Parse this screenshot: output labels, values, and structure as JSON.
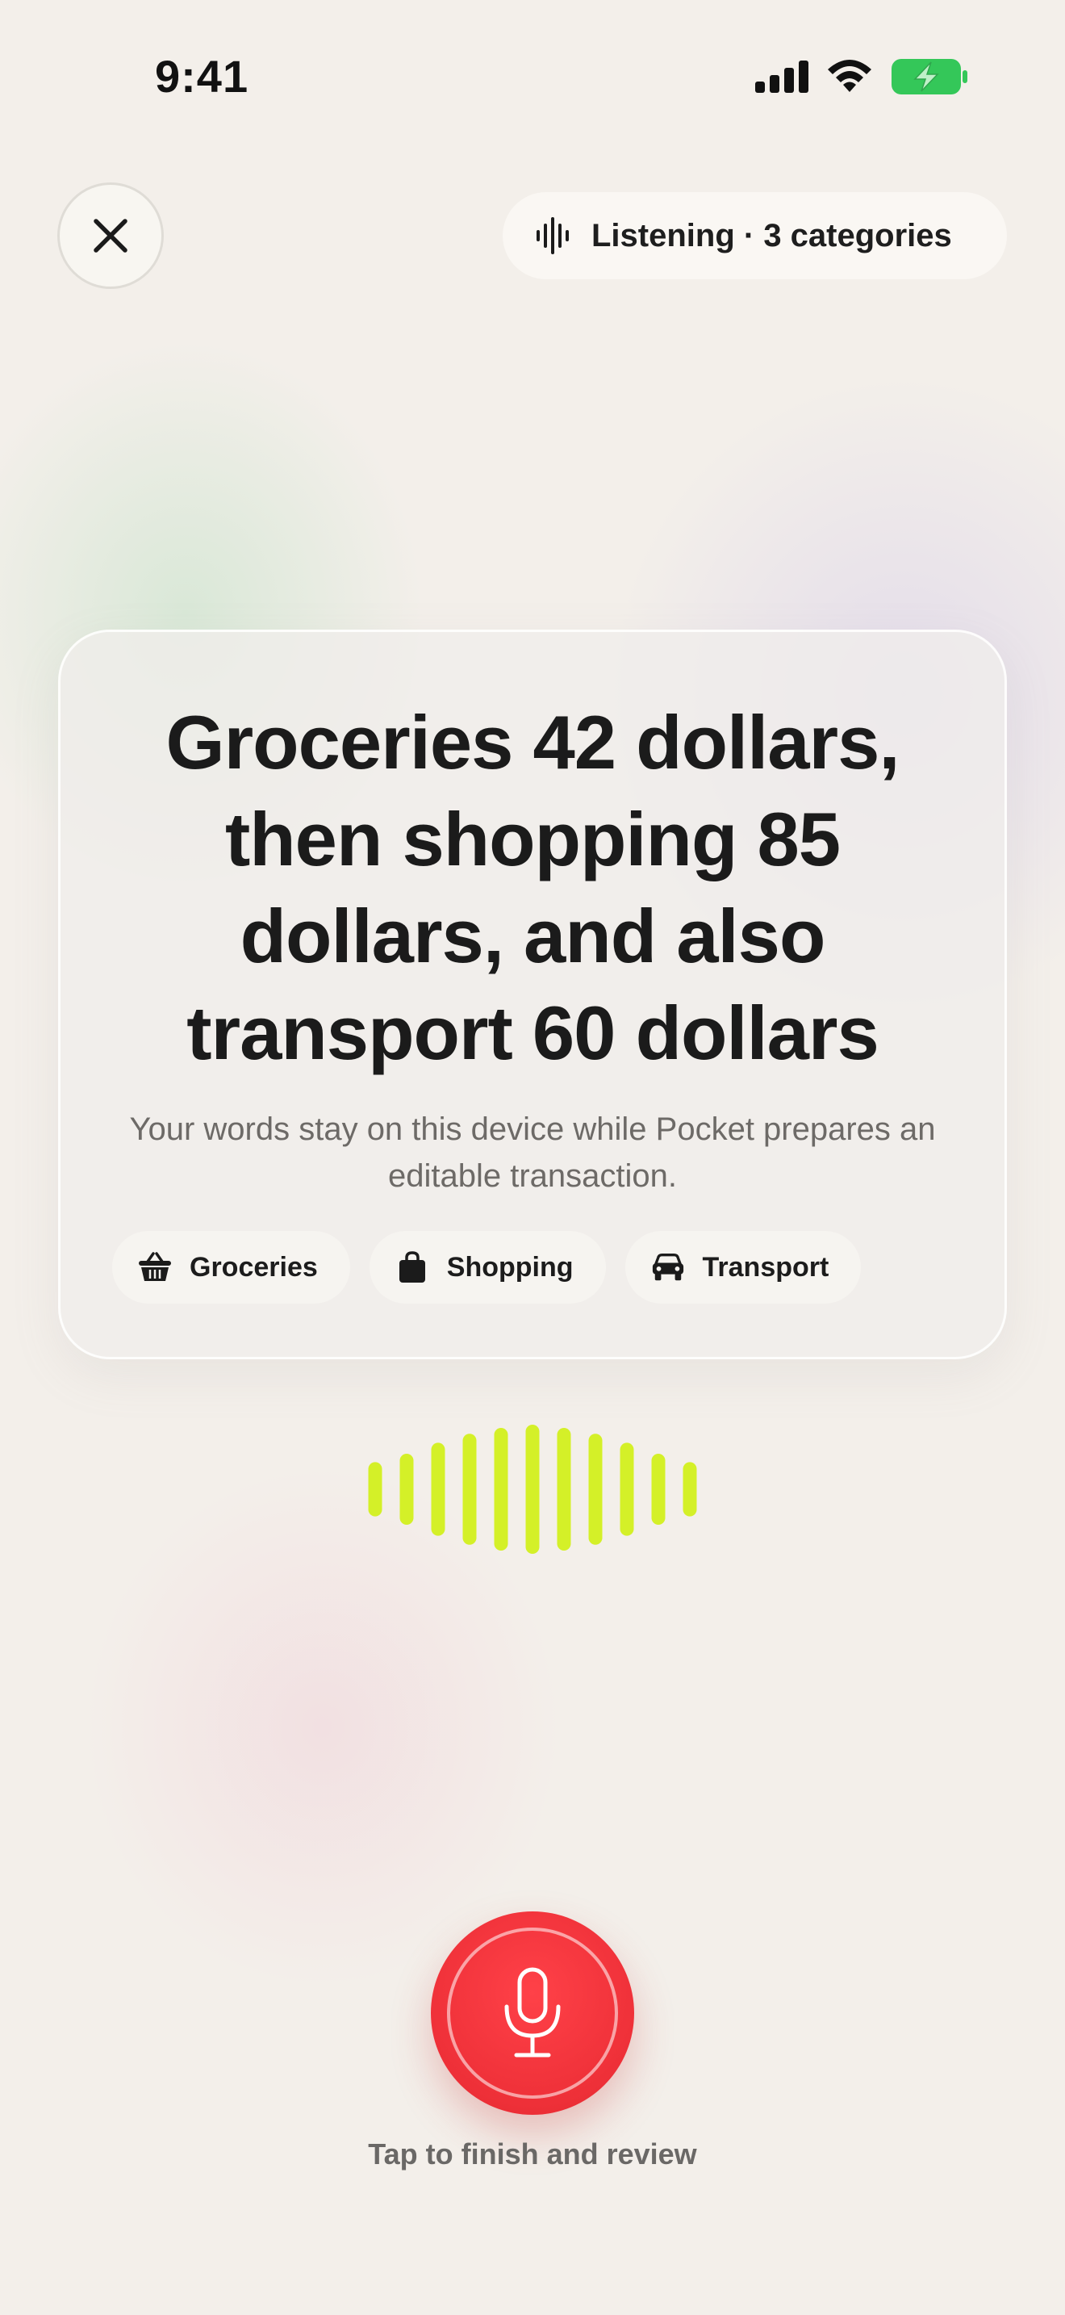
{
  "status_bar": {
    "time": "9:41",
    "icons": [
      "cellular-signal-icon",
      "wifi-icon",
      "battery-charging-icon"
    ],
    "battery_color": "#34c759"
  },
  "header": {
    "close_icon": "close-icon",
    "listening_icon": "waveform-icon",
    "listening_label": "Listening · 3 categories"
  },
  "transcript": {
    "text": "Groceries 42 dollars, then shopping 85 dollars, and also transport 60 dollars",
    "privacy_note": "Your words stay on this device while Pocket prepares an editable transaction."
  },
  "categories": [
    {
      "label": "Groceries",
      "icon": "basket-icon"
    },
    {
      "label": "Shopping",
      "icon": "shopping-bag-icon"
    },
    {
      "label": "Transport",
      "icon": "car-icon"
    }
  ],
  "waveform": {
    "color": "#d4f028",
    "levels": [
      0.42,
      0.55,
      0.72,
      0.86,
      0.95,
      1.0,
      0.95,
      0.86,
      0.72,
      0.55,
      0.42
    ]
  },
  "record": {
    "icon": "microphone-icon",
    "color": "#f0343c",
    "hint": "Tap to finish and review"
  }
}
